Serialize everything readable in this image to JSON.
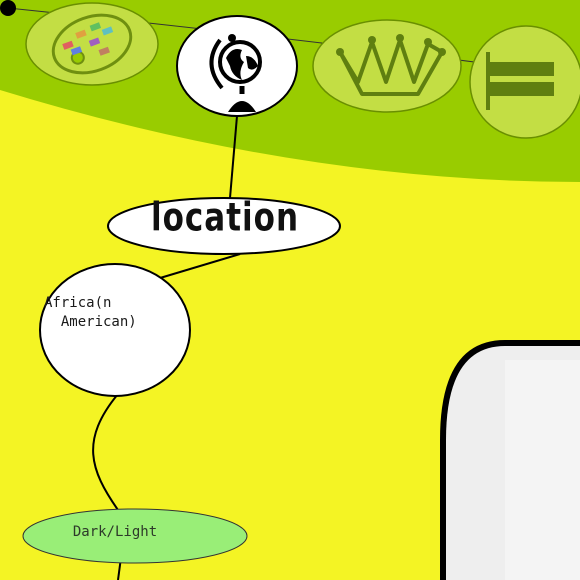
{
  "toolbar": {
    "icons": [
      "palette-icon",
      "globe-icon",
      "crown-icon",
      "flag-icon"
    ],
    "active_icon": "globe-icon"
  },
  "nodes": {
    "location": {
      "label": "location"
    },
    "origin": {
      "label": "Africa(n\n  American)"
    },
    "complexion": {
      "label": "Dark/Light"
    }
  },
  "colors": {
    "background": "#f4f424",
    "toolbar_band": "#99cc00",
    "toolbar_button": "#c3de44",
    "selected_node": "#ffffff",
    "leaf_node": "#99ee77",
    "panel_border": "#000000",
    "panel_fill": "#eeeeee"
  }
}
